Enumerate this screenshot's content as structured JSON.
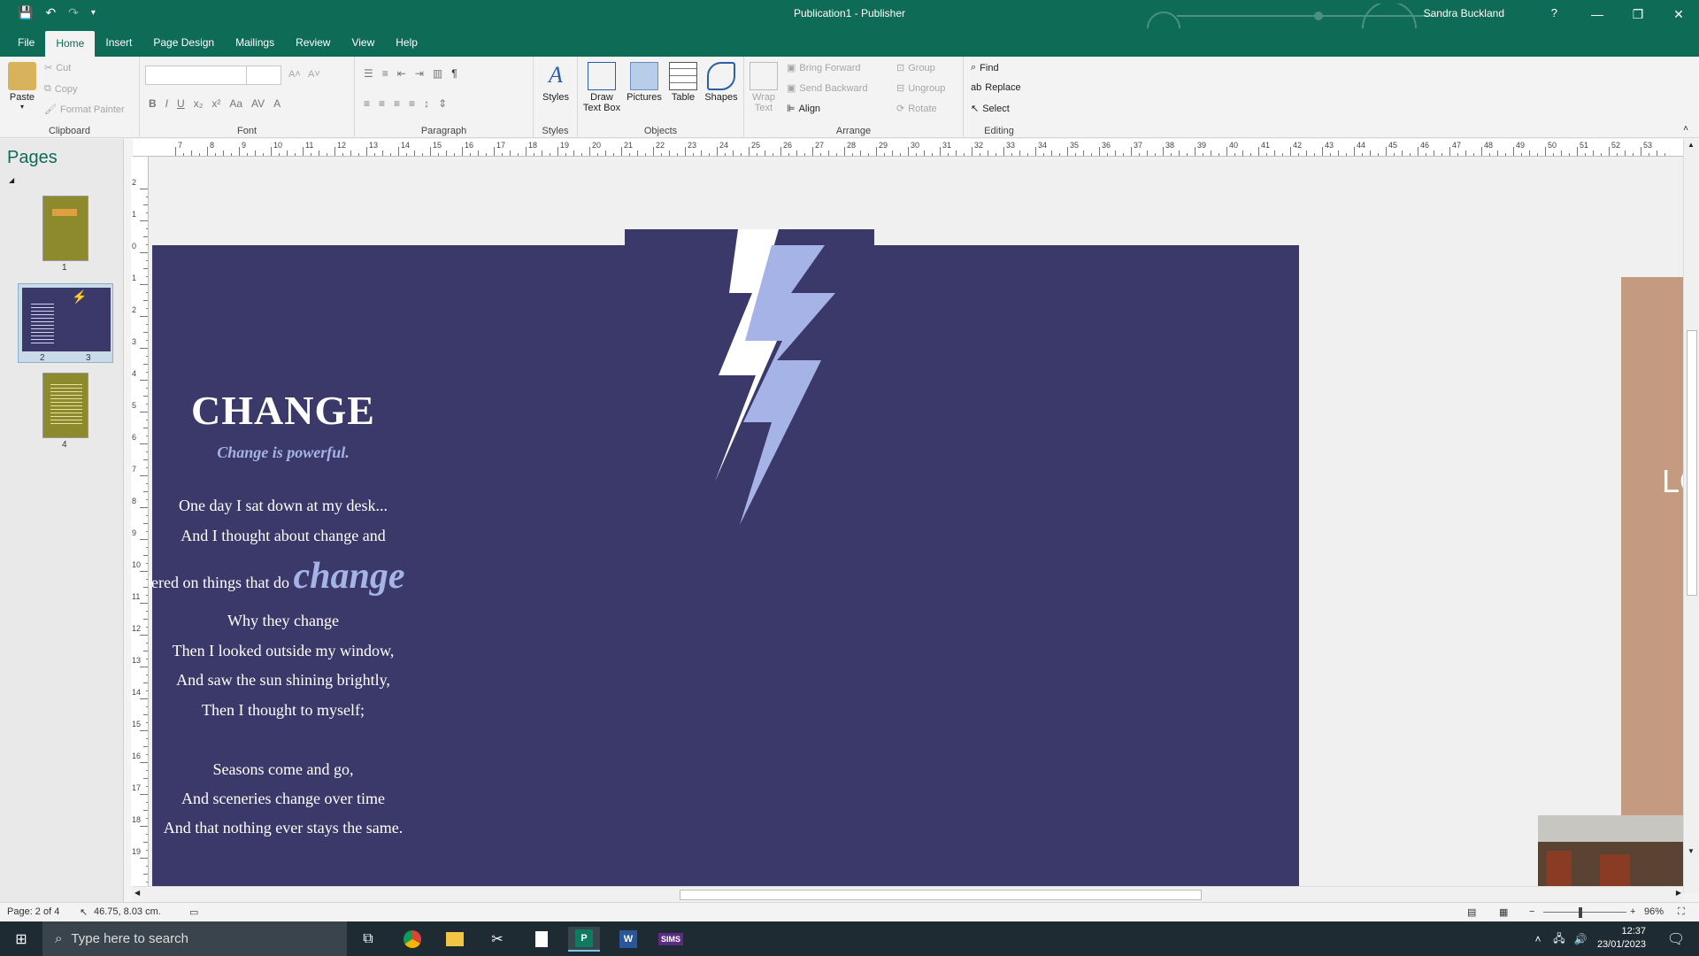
{
  "app": {
    "title": "Publication1 - Publisher",
    "user": "Sandra Buckland",
    "help": "?"
  },
  "tabs": [
    "File",
    "Home",
    "Insert",
    "Page Design",
    "Mailings",
    "Review",
    "View",
    "Help"
  ],
  "ribbon": {
    "clipboard": {
      "label": "Clipboard",
      "paste": "Paste",
      "cut": "Cut",
      "copy": "Copy",
      "format_painter": "Format Painter"
    },
    "font": {
      "label": "Font",
      "bold": "B",
      "italic": "I",
      "underline": "U",
      "grow": "A˄",
      "shrink": "A˅"
    },
    "paragraph": {
      "label": "Paragraph",
      "pilcrow": "¶"
    },
    "styles": {
      "label": "Styles",
      "styles_btn": "Styles"
    },
    "objects": {
      "label": "Objects",
      "draw_text_box_1": "Draw",
      "draw_text_box_2": "Text Box",
      "pictures": "Pictures",
      "table": "Table",
      "shapes": "Shapes"
    },
    "arrange": {
      "label": "Arrange",
      "wrap_text_1": "Wrap",
      "wrap_text_2": "Text",
      "bring_forward": "Bring Forward",
      "send_backward": "Send Backward",
      "align": "Align",
      "group": "Group",
      "ungroup": "Ungroup",
      "rotate": "Rotate"
    },
    "editing": {
      "label": "Editing",
      "find": "Find",
      "replace": "Replace",
      "select": "Select"
    }
  },
  "pages_pane": {
    "title": "Pages",
    "thumbs": [
      {
        "label": "1",
        "color": "#8c8a2c"
      },
      {
        "label_left": "2",
        "label_right": "3",
        "color": "#3b3969"
      },
      {
        "label": "4",
        "color": "#8c8a2c"
      }
    ]
  },
  "document": {
    "title": "CHANGE",
    "subtitle": "Change is powerful.",
    "lines": [
      "One day I sat down at my desk...",
      "And I thought about change and",
      "dered on things that do",
      "change",
      "Why they change",
      "Then I looked outside my window,",
      "And saw the sun shining brightly,",
      "Then I thought to myself;",
      "Seasons come and go,",
      "And sceneries change over time",
      "And that nothing ever stays the same."
    ],
    "right_page_text": "LO",
    "colors": {
      "page_bg": "#3b3969",
      "accent": "#a6b3e6",
      "tan": "#c49a80"
    }
  },
  "rulers": {
    "h_labels": [
      "7",
      "8",
      "9",
      "10",
      "11",
      "12",
      "13",
      "14",
      "15",
      "16",
      "17",
      "18",
      "19",
      "20",
      "21",
      "22",
      "23",
      "24",
      "25",
      "26",
      "27",
      "28",
      "29",
      "30",
      "31",
      "32",
      "33",
      "34",
      "35",
      "36",
      "37",
      "38",
      "39",
      "40",
      "41",
      "42",
      "43",
      "44",
      "45",
      "46",
      "47",
      "48",
      "49",
      "50",
      "51",
      "52",
      "53"
    ],
    "v_labels": [
      "2",
      "1",
      "0",
      "1",
      "2",
      "3",
      "4",
      "5",
      "6",
      "7",
      "8",
      "9",
      "10",
      "11",
      "12",
      "13",
      "14",
      "15",
      "16",
      "17",
      "18",
      "19"
    ]
  },
  "status": {
    "page": "Page: 2 of 4",
    "position": "46.75, 8.03 cm.",
    "zoom": "96%"
  },
  "taskbar": {
    "search_placeholder": "Type here to search",
    "time": "12:37",
    "date": "23/01/2023",
    "sims": "SIMS"
  }
}
